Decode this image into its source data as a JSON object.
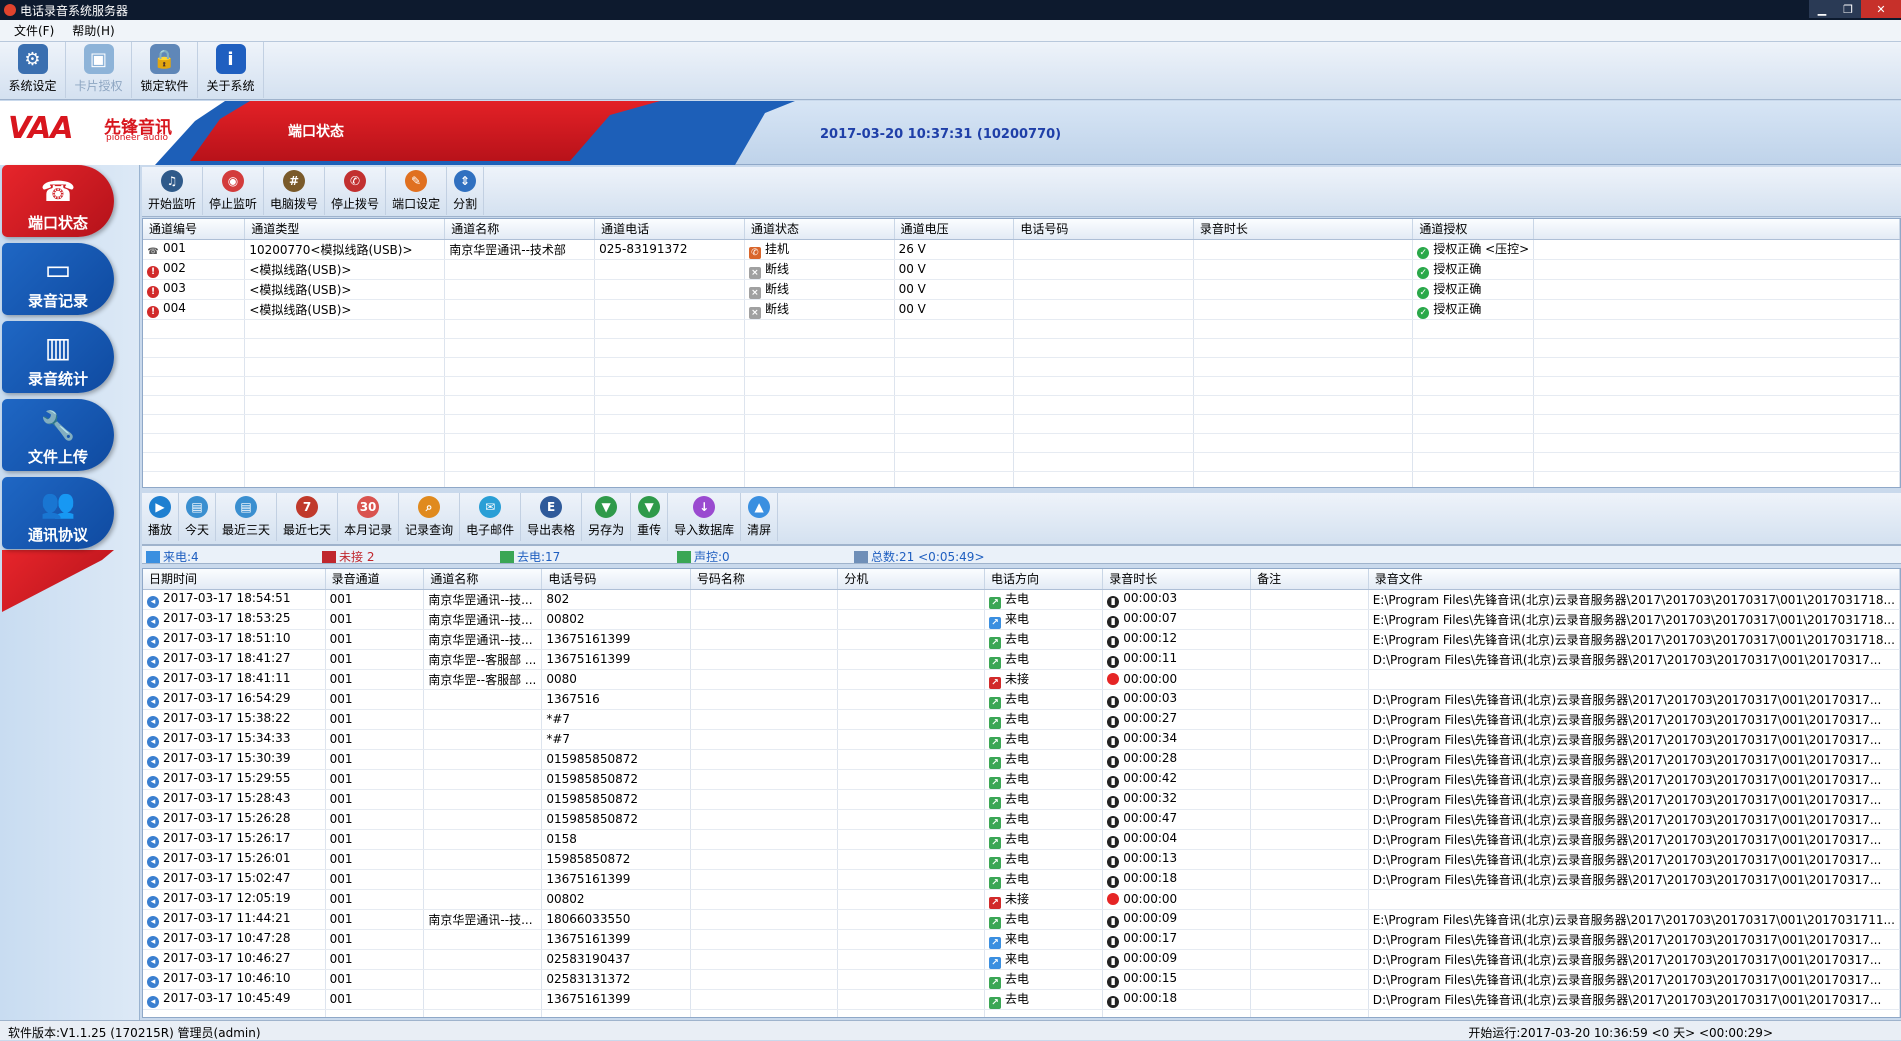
{
  "window": {
    "title": "电话录音系统服务器",
    "min": "▁",
    "max": "❐",
    "close": "✕"
  },
  "menu": [
    "文件(F)",
    "帮助(H)"
  ],
  "toolbar": [
    {
      "label": "系统设定",
      "icon": "gear-icon",
      "glyph": "⚙",
      "color": "#3a6fb0",
      "disabled": false
    },
    {
      "label": "卡片授权",
      "icon": "card-icon",
      "glyph": "▣",
      "color": "#8db3d8",
      "disabled": true
    },
    {
      "label": "锁定软件",
      "icon": "lock-icon",
      "glyph": "🔒",
      "color": "#5f87b8",
      "disabled": false
    },
    {
      "label": "关于系统",
      "icon": "info-icon",
      "glyph": "i",
      "color": "#1f5fc0",
      "disabled": false
    }
  ],
  "banner": {
    "logo": "VAA",
    "logo_cn": "先锋音讯",
    "logo_en": "pioneer audio",
    "section_title": "端口状态",
    "datetime": "2017-03-20 10:37:31 (10200770)"
  },
  "nav": [
    {
      "label": "端口状态",
      "icon": "port-status-icon",
      "glyph": "☎",
      "active": true
    },
    {
      "label": "录音记录",
      "icon": "cassette-icon",
      "glyph": "▭",
      "active": false
    },
    {
      "label": "录音统计",
      "icon": "bar-chart-icon",
      "glyph": "▥",
      "active": false
    },
    {
      "label": "文件上传",
      "icon": "wrench-icon",
      "glyph": "🔧",
      "active": false
    },
    {
      "label": "通讯协议",
      "icon": "users-icon",
      "glyph": "👥",
      "active": false
    }
  ],
  "port_toolbar": [
    {
      "label": "开始监听",
      "icon": "headphones-icon",
      "glyph": "♫",
      "color": "#2f5a8a"
    },
    {
      "label": "停止监听",
      "icon": "stop-listen-icon",
      "glyph": "◉",
      "color": "#d33b3b"
    },
    {
      "label": "电脑拨号",
      "icon": "dialpad-icon",
      "glyph": "#",
      "color": "#7a5a2a"
    },
    {
      "label": "停止拨号",
      "icon": "hangup-icon",
      "glyph": "✆",
      "color": "#c23030"
    },
    {
      "label": "端口设定",
      "icon": "port-settings-icon",
      "glyph": "✎",
      "color": "#e07020"
    },
    {
      "label": "分割",
      "icon": "split-icon",
      "glyph": "⇕",
      "color": "#3070c0"
    }
  ],
  "ports": {
    "columns": [
      "通道编号",
      "通道类型",
      "通道名称",
      "通道电话",
      "通道状态",
      "通道电压",
      "电话号码",
      "录音时长",
      "通道授权"
    ],
    "rows": [
      {
        "id": "001",
        "type": "10200770<模拟线路(USB)>",
        "name": "南京华罡通讯--技术部",
        "phone": "025-83191372",
        "status": "挂机",
        "voltage": "26 V",
        "number": "",
        "duration": "",
        "auth": "授权正确 <压控>",
        "ok": true
      },
      {
        "id": "002",
        "type": "<模拟线路(USB)>",
        "name": "",
        "phone": "",
        "status": "断线",
        "voltage": "00 V",
        "number": "",
        "duration": "",
        "auth": "授权正确",
        "ok": false
      },
      {
        "id": "003",
        "type": "<模拟线路(USB)>",
        "name": "",
        "phone": "",
        "status": "断线",
        "voltage": "00 V",
        "number": "",
        "duration": "",
        "auth": "授权正确",
        "ok": false
      },
      {
        "id": "004",
        "type": "<模拟线路(USB)>",
        "name": "",
        "phone": "",
        "status": "断线",
        "voltage": "00 V",
        "number": "",
        "duration": "",
        "auth": "授权正确",
        "ok": false
      }
    ]
  },
  "rec_toolbar": [
    {
      "label": "播放",
      "icon": "play-icon",
      "glyph": "▶",
      "color": "#1e7fd0"
    },
    {
      "label": "今天",
      "icon": "today-icon",
      "glyph": "▤",
      "color": "#3a8fd0"
    },
    {
      "label": "最近三天",
      "icon": "three-days-icon",
      "glyph": "▤",
      "color": "#3a8fd0"
    },
    {
      "label": "最近七天",
      "icon": "calendar-icon",
      "glyph": "7",
      "color": "#c0392b"
    },
    {
      "label": "本月记录",
      "icon": "month-icon",
      "glyph": "30",
      "color": "#d9534f"
    },
    {
      "label": "记录查询",
      "icon": "search-icon",
      "glyph": "⌕",
      "color": "#e08a1e"
    },
    {
      "label": "电子邮件",
      "icon": "email-icon",
      "glyph": "✉",
      "color": "#2a9fd6"
    },
    {
      "label": "导出表格",
      "icon": "export-icon",
      "glyph": "E",
      "color": "#2f5a9a"
    },
    {
      "label": "另存为",
      "icon": "save-as-icon",
      "glyph": "▼",
      "color": "#2f9a4a"
    },
    {
      "label": "重传",
      "icon": "resend-icon",
      "glyph": "▼",
      "color": "#2f9a4a"
    },
    {
      "label": "导入数据库",
      "icon": "import-db-icon",
      "glyph": "↓",
      "color": "#9a4ad0"
    },
    {
      "label": "清屏",
      "icon": "clear-icon",
      "glyph": "▲",
      "color": "#3a8fe0"
    }
  ],
  "summary": {
    "incoming": "来电:4",
    "missed": "未接 2",
    "outgoing": "去电:17",
    "voice": "声控:0",
    "total": "总数:21 <0:05:49>"
  },
  "records": {
    "columns": [
      "日期时间",
      "录音通道",
      "通道名称",
      "电话号码",
      "号码名称",
      "分机",
      "电话方向",
      "录音时长",
      "备注",
      "录音文件"
    ],
    "rows": [
      [
        "2017-03-17 18:54:51",
        "001",
        "南京华罡通讯--技...",
        "802",
        "",
        "",
        "去电",
        "00:00:03",
        "",
        "E:\\Program Files\\先锋音讯(北京)云录音服务器\\2017\\201703\\20170317\\001\\2017031718..."
      ],
      [
        "2017-03-17 18:53:25",
        "001",
        "南京华罡通讯--技...",
        "00802",
        "",
        "",
        "来电",
        "00:00:07",
        "",
        "E:\\Program Files\\先锋音讯(北京)云录音服务器\\2017\\201703\\20170317\\001\\2017031718..."
      ],
      [
        "2017-03-17 18:51:10",
        "001",
        "南京华罡通讯--技...",
        "13675161399",
        "",
        "",
        "去电",
        "00:00:12",
        "",
        "E:\\Program Files\\先锋音讯(北京)云录音服务器\\2017\\201703\\20170317\\001\\2017031718..."
      ],
      [
        "2017-03-17 18:41:27",
        "001",
        "南京华罡--客服部 ...",
        "13675161399",
        "",
        "",
        "去电",
        "00:00:11",
        "",
        "D:\\Program Files\\先锋音讯(北京)云录音服务器\\2017\\201703\\20170317\\001\\20170317..."
      ],
      [
        "2017-03-17 18:41:11",
        "001",
        "南京华罡--客服部 ...",
        "0080",
        "",
        "",
        "未接",
        "00:00:00",
        "",
        ""
      ],
      [
        "2017-03-17 16:54:29",
        "001",
        "",
        "1367516",
        "",
        "",
        "去电",
        "00:00:03",
        "",
        "D:\\Program Files\\先锋音讯(北京)云录音服务器\\2017\\201703\\20170317\\001\\20170317..."
      ],
      [
        "2017-03-17 15:38:22",
        "001",
        "",
        "*#7",
        "",
        "",
        "去电",
        "00:00:27",
        "",
        "D:\\Program Files\\先锋音讯(北京)云录音服务器\\2017\\201703\\20170317\\001\\20170317..."
      ],
      [
        "2017-03-17 15:34:33",
        "001",
        "",
        "*#7",
        "",
        "",
        "去电",
        "00:00:34",
        "",
        "D:\\Program Files\\先锋音讯(北京)云录音服务器\\2017\\201703\\20170317\\001\\20170317..."
      ],
      [
        "2017-03-17 15:30:39",
        "001",
        "",
        "015985850872",
        "",
        "",
        "去电",
        "00:00:28",
        "",
        "D:\\Program Files\\先锋音讯(北京)云录音服务器\\2017\\201703\\20170317\\001\\20170317..."
      ],
      [
        "2017-03-17 15:29:55",
        "001",
        "",
        "015985850872",
        "",
        "",
        "去电",
        "00:00:42",
        "",
        "D:\\Program Files\\先锋音讯(北京)云录音服务器\\2017\\201703\\20170317\\001\\20170317..."
      ],
      [
        "2017-03-17 15:28:43",
        "001",
        "",
        "015985850872",
        "",
        "",
        "去电",
        "00:00:32",
        "",
        "D:\\Program Files\\先锋音讯(北京)云录音服务器\\2017\\201703\\20170317\\001\\20170317..."
      ],
      [
        "2017-03-17 15:26:28",
        "001",
        "",
        "015985850872",
        "",
        "",
        "去电",
        "00:00:47",
        "",
        "D:\\Program Files\\先锋音讯(北京)云录音服务器\\2017\\201703\\20170317\\001\\20170317..."
      ],
      [
        "2017-03-17 15:26:17",
        "001",
        "",
        "0158",
        "",
        "",
        "去电",
        "00:00:04",
        "",
        "D:\\Program Files\\先锋音讯(北京)云录音服务器\\2017\\201703\\20170317\\001\\20170317..."
      ],
      [
        "2017-03-17 15:26:01",
        "001",
        "",
        "15985850872",
        "",
        "",
        "去电",
        "00:00:13",
        "",
        "D:\\Program Files\\先锋音讯(北京)云录音服务器\\2017\\201703\\20170317\\001\\20170317..."
      ],
      [
        "2017-03-17 15:02:47",
        "001",
        "",
        "13675161399",
        "",
        "",
        "去电",
        "00:00:18",
        "",
        "D:\\Program Files\\先锋音讯(北京)云录音服务器\\2017\\201703\\20170317\\001\\20170317..."
      ],
      [
        "2017-03-17 12:05:19",
        "001",
        "",
        "00802",
        "",
        "",
        "未接",
        "00:00:00",
        "",
        ""
      ],
      [
        "2017-03-17 11:44:21",
        "001",
        "南京华罡通讯--技...",
        "18066033550",
        "",
        "",
        "去电",
        "00:00:09",
        "",
        "E:\\Program Files\\先锋音讯(北京)云录音服务器\\2017\\201703\\20170317\\001\\2017031711..."
      ],
      [
        "2017-03-17 10:47:28",
        "001",
        "",
        "13675161399",
        "",
        "",
        "来电",
        "00:00:17",
        "",
        "D:\\Program Files\\先锋音讯(北京)云录音服务器\\2017\\201703\\20170317\\001\\20170317..."
      ],
      [
        "2017-03-17 10:46:27",
        "001",
        "",
        "02583190437",
        "",
        "",
        "来电",
        "00:00:09",
        "",
        "D:\\Program Files\\先锋音讯(北京)云录音服务器\\2017\\201703\\20170317\\001\\20170317..."
      ],
      [
        "2017-03-17 10:46:10",
        "001",
        "",
        "02583131372",
        "",
        "",
        "去电",
        "00:00:15",
        "",
        "D:\\Program Files\\先锋音讯(北京)云录音服务器\\2017\\201703\\20170317\\001\\20170317..."
      ],
      [
        "2017-03-17 10:45:49",
        "001",
        "",
        "13675161399",
        "",
        "",
        "去电",
        "00:00:18",
        "",
        "D:\\Program Files\\先锋音讯(北京)云录音服务器\\2017\\201703\\20170317\\001\\20170317..."
      ]
    ]
  },
  "footer": {
    "left": "软件版本:V1.1.25 (170215R) 管理员(admin)",
    "right": "开始运行:2017-03-20 10:36:59 <0 天> <00:00:29>"
  },
  "colors": {
    "out": "#3aa655",
    "in": "#3a8fe0",
    "missed": "#d12a2a",
    "ok": "#2aa84a",
    "err": "#d12a2a"
  }
}
